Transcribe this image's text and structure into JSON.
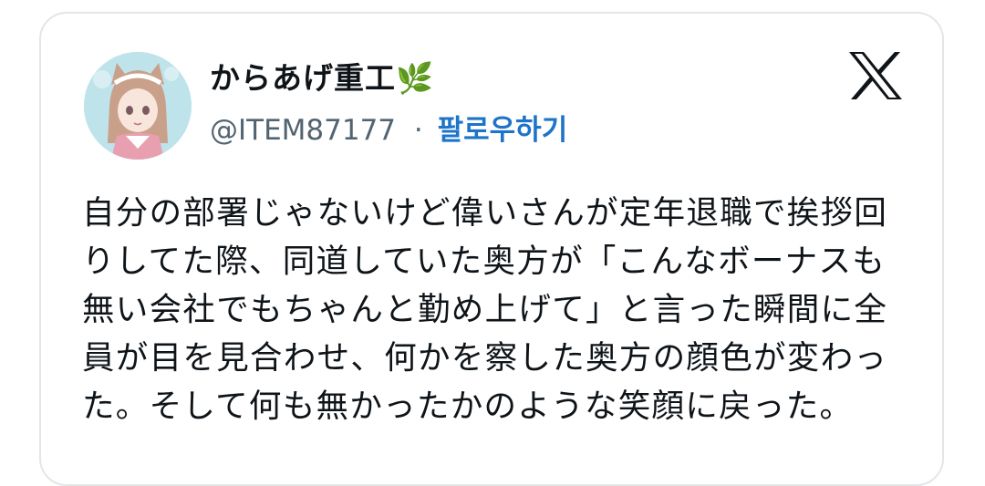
{
  "tweet": {
    "author": {
      "display_name": "からあげ重工🌿",
      "handle": "@ITEM87177",
      "separator": "·",
      "follow_label": "팔로우하기",
      "avatar_icon": "avatar-anime-girl"
    },
    "logo_icon": "x-logo",
    "text_lines": [
      "自分の部署じゃないけど偉いさんが定年退職で挨拶回",
      "りしてた際、同道していた奥方が「こんなボーナスも",
      "無い会社でもちゃんと勤め上げて」と言った瞬間に全",
      "員が目を見合わせ、何かを察した奥方の顔色が変わっ",
      "た。そして何も無かったかのような笑顔に戻った。"
    ]
  },
  "colors": {
    "follow": "#1d74c8",
    "text": "#0f1419",
    "secondary": "#536471",
    "border": "#e3e6e8"
  }
}
